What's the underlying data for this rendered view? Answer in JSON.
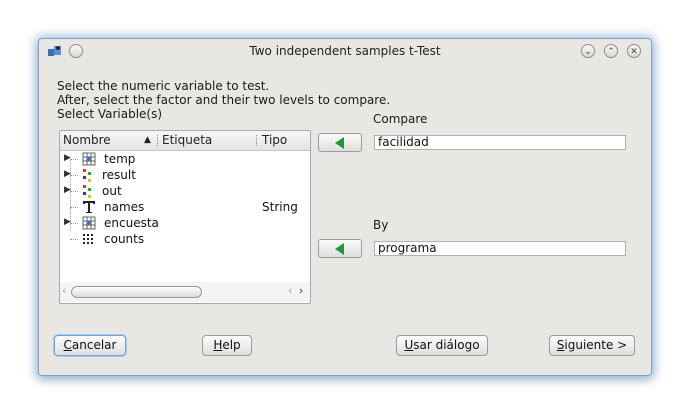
{
  "window": {
    "title": "Two independent samples t-Test",
    "buttons": {
      "minimize": "⌄",
      "maximize": "⌃",
      "close": "✕"
    }
  },
  "instructions": {
    "line1": "Select the numeric variable to test.",
    "line2": "After, select the factor and their two levels to compare.",
    "line3": "Select Variable(s)"
  },
  "variables": {
    "columns": [
      "Nombre",
      "Etiqueta",
      "Tipo"
    ],
    "rows": [
      {
        "name": "temp",
        "label": "",
        "type": "",
        "icon": "dataset-icon",
        "expandable": true
      },
      {
        "name": "result",
        "label": "",
        "type": "",
        "icon": "list-icon",
        "expandable": true
      },
      {
        "name": "out",
        "label": "",
        "type": "",
        "icon": "list-icon",
        "expandable": true
      },
      {
        "name": "names",
        "label": "",
        "type": "String",
        "icon": "text-type-icon",
        "expandable": false
      },
      {
        "name": "encuesta",
        "label": "",
        "type": "",
        "icon": "dataset-icon",
        "expandable": true
      },
      {
        "name": "counts",
        "label": "",
        "type": "",
        "icon": "numeric-grid-icon",
        "expandable": false
      }
    ]
  },
  "compare": {
    "label": "Compare",
    "value": "facilidad"
  },
  "by": {
    "label": "By",
    "value": "programa"
  },
  "footer": {
    "cancel": {
      "u": "C",
      "rest": "ancelar"
    },
    "help": {
      "u": "H",
      "rest": "elp"
    },
    "dialog": {
      "u": "U",
      "rest": "sar diálogo"
    },
    "next": {
      "u": "S",
      "rest": "iguiente >"
    }
  },
  "colors": {
    "accent_arrow": "#1e9a2e",
    "focus_border": "#6fa2d6",
    "window_border": "#7aa1c8"
  }
}
